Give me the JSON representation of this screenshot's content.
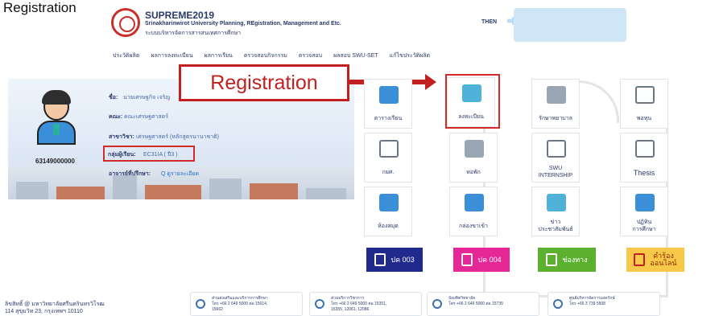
{
  "page_header": "Registration",
  "app": {
    "title": "SUPREME2019",
    "subtitle_en": "Srinakharinwirot University Planning, REgistration, Management and Etc.",
    "subtitle_th": "ระบบบริหารจัดการสารสนเทศการศึกษา"
  },
  "user": {
    "name": "THEN"
  },
  "nav": [
    "ประวัติผลิต",
    "ผลการลงทะเบียน",
    "ผลการเรียน",
    "ตรวจสอบกิจกรรม",
    "ตรวจสอบ",
    "ผลสอบ SWU-SET",
    "แก้ไขประวัติผลิต"
  ],
  "profile": {
    "student_id": "63149000000",
    "name_label": "ชื่อ:",
    "name_value": "นายเศรษฐกิจ เจริญ",
    "faculty_label": "คณะ:",
    "faculty_value": "คณะเศรษฐศาสตร์",
    "major_label": "สาขาวิชา:",
    "major_value": "เศรษฐศาสตร์ (หลักสูตรนานาชาติ)",
    "group_label": "กลุ่มผู้เรียน:",
    "group_value": "EC31IA ( ปี3 )",
    "advisor_label": "อาจารย์ที่ปรึกษา:",
    "advisor_value": "ดูรายละเอียด"
  },
  "callout": {
    "text": "Registration"
  },
  "tiles": {
    "timetable": "ตารางเรียน",
    "register": "ลงทะเบียน",
    "healthcare": "รักษาพยาบาล",
    "scholarship": "พอทุน",
    "student_loan": "กยศ.",
    "dormitory": "หอพัก",
    "internship_1": "SWU",
    "internship_2": "INTERNSHIP",
    "thesis": "Thesis",
    "library": "ห้องสมุด",
    "inbox": "กล่องขาเข้า",
    "news_1": "ข่าว",
    "news_2": "ประชาสัมพันธ์",
    "calendar_1": "ปฏิทิน",
    "calendar_2": "การศึกษา"
  },
  "forms": {
    "form_003": "ปค 003",
    "form_004": "ปค 004",
    "contact": "ช่องทาง",
    "petition_1": "คำร้อง",
    "petition_2": "ออนไลน์"
  },
  "footer": {
    "copyright": "ลิขสิทธิ์ @ มหาวิทยาลัยศรีนครินทรวิโรฒ",
    "address": "114 สุขุมวิท 23, กรุงเทพฯ 10110",
    "contacts": [
      {
        "line1": "ส่วนส่งเสริมและบริการการศึกษา",
        "line2": "โทร +66 2 649 5000 ต่อ 15614,",
        "line3": "15662"
      },
      {
        "line1": "ส่วนบริการวิชาการ",
        "line2": "โทร +66 2 649 5000 ต่อ 15351,",
        "line3": "15355, 12061, 12086"
      },
      {
        "line1": "บัณฑิตวิทยาลัย",
        "line2": "โทร +66 2 649 5000 ต่อ 15730",
        "line3": ""
      },
      {
        "line1": "ศูนย์บริหารจัดการองครักษ์",
        "line2": "โทร +66 3 739 5508",
        "line3": ""
      }
    ]
  },
  "colors": {
    "brand_red": "#c0201f",
    "nav_text": "#2b3a6a",
    "form_003_bg": "#1f2a8c",
    "form_004_bg": "#e62896",
    "contact_bg": "#5cb030",
    "petition_bg": "#f7c84a"
  }
}
